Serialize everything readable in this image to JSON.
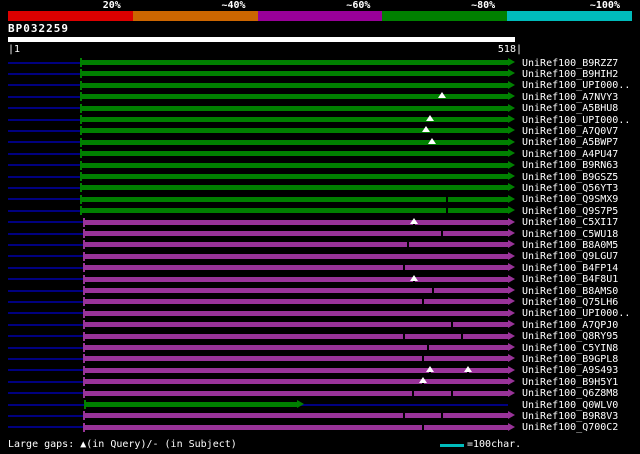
{
  "colors": {
    "background": "#000000",
    "text": "#ffffff",
    "navy_line": "#000080",
    "green_bar": "#008000",
    "purple_bar": "#993399",
    "cyan": "#00bbbb"
  },
  "identity_scale": {
    "labels": [
      "20%",
      "~40%",
      "~60%",
      "~80%",
      "~100%"
    ],
    "colors": [
      "#dd0000",
      "#cc6600",
      "#990099",
      "#008000",
      "#00bbbb"
    ]
  },
  "query": {
    "name": "BP032259",
    "ruler_start": "|1",
    "ruler_end": "518|",
    "length": 518
  },
  "chart_data": {
    "type": "bar",
    "subtype": "sequence-alignment-overview",
    "x_domain": [
      1,
      518
    ],
    "query_name": "BP032259",
    "rows": [
      {
        "label": "UniRef100_B9RZZ7",
        "color": "green",
        "start": 75,
        "end": 518,
        "query_gaps": [],
        "subject_gaps": []
      },
      {
        "label": "UniRef100_B9HIH2",
        "color": "green",
        "start": 75,
        "end": 518,
        "query_gaps": [],
        "subject_gaps": []
      },
      {
        "label": "UniRef100_UPI000..",
        "color": "green",
        "start": 75,
        "end": 518,
        "query_gaps": [],
        "subject_gaps": []
      },
      {
        "label": "UniRef100_A7NVY3",
        "color": "green",
        "start": 75,
        "end": 518,
        "query_gaps": [
          450
        ],
        "subject_gaps": []
      },
      {
        "label": "UniRef100_A5BHU8",
        "color": "green",
        "start": 75,
        "end": 518,
        "query_gaps": [],
        "subject_gaps": []
      },
      {
        "label": "UniRef100_UPI000..",
        "color": "green",
        "start": 75,
        "end": 518,
        "query_gaps": [
          437
        ],
        "subject_gaps": []
      },
      {
        "label": "UniRef100_A7Q0V7",
        "color": "green",
        "start": 75,
        "end": 518,
        "query_gaps": [
          433
        ],
        "subject_gaps": []
      },
      {
        "label": "UniRef100_A5BWP7",
        "color": "green",
        "start": 75,
        "end": 518,
        "query_gaps": [
          439
        ],
        "subject_gaps": []
      },
      {
        "label": "UniRef100_A4PU47",
        "color": "green",
        "start": 75,
        "end": 518,
        "query_gaps": [],
        "subject_gaps": []
      },
      {
        "label": "UniRef100_B9RN63",
        "color": "green",
        "start": 75,
        "end": 518,
        "query_gaps": [],
        "subject_gaps": []
      },
      {
        "label": "UniRef100_B9GSZ5",
        "color": "green",
        "start": 75,
        "end": 518,
        "query_gaps": [],
        "subject_gaps": []
      },
      {
        "label": "UniRef100_Q56YT3",
        "color": "green",
        "start": 75,
        "end": 518,
        "query_gaps": [],
        "subject_gaps": []
      },
      {
        "label": "UniRef100_Q9SMX9",
        "color": "green",
        "start": 75,
        "end": 518,
        "query_gaps": [],
        "subject_gaps": [
          455
        ]
      },
      {
        "label": "UniRef100_Q9S7P5",
        "color": "green",
        "start": 75,
        "end": 518,
        "query_gaps": [],
        "subject_gaps": [
          455
        ]
      },
      {
        "label": "UniRef100_C5XI17",
        "color": "purple",
        "start": 79,
        "end": 518,
        "query_gaps": [
          421
        ],
        "subject_gaps": [
          421
        ]
      },
      {
        "label": "UniRef100_C5WU18",
        "color": "purple",
        "start": 79,
        "end": 518,
        "query_gaps": [],
        "subject_gaps": [
          450
        ]
      },
      {
        "label": "UniRef100_B8A0M5",
        "color": "purple",
        "start": 79,
        "end": 518,
        "query_gaps": [],
        "subject_gaps": [
          415
        ]
      },
      {
        "label": "UniRef100_Q9LGU7",
        "color": "purple",
        "start": 79,
        "end": 518,
        "query_gaps": [],
        "subject_gaps": []
      },
      {
        "label": "UniRef100_B4FP14",
        "color": "purple",
        "start": 79,
        "end": 518,
        "query_gaps": [],
        "subject_gaps": [
          410
        ]
      },
      {
        "label": "UniRef100_B4F8U1",
        "color": "purple",
        "start": 79,
        "end": 518,
        "query_gaps": [
          421
        ],
        "subject_gaps": [
          421
        ]
      },
      {
        "label": "UniRef100_B8AMS0",
        "color": "purple",
        "start": 79,
        "end": 518,
        "query_gaps": [],
        "subject_gaps": [
          440
        ]
      },
      {
        "label": "UniRef100_Q75LH6",
        "color": "purple",
        "start": 79,
        "end": 518,
        "query_gaps": [],
        "subject_gaps": [
          430
        ]
      },
      {
        "label": "UniRef100_UPI000..",
        "color": "purple",
        "start": 79,
        "end": 518,
        "query_gaps": [],
        "subject_gaps": []
      },
      {
        "label": "UniRef100_A7QPJ0",
        "color": "purple",
        "start": 79,
        "end": 518,
        "query_gaps": [],
        "subject_gaps": [
          460
        ]
      },
      {
        "label": "UniRef100_Q8RY95",
        "color": "purple",
        "start": 79,
        "end": 518,
        "query_gaps": [],
        "subject_gaps": [
          410,
          470
        ]
      },
      {
        "label": "UniRef100_C5YIN8",
        "color": "purple",
        "start": 79,
        "end": 518,
        "query_gaps": [],
        "subject_gaps": [
          435
        ]
      },
      {
        "label": "UniRef100_B9GPL8",
        "color": "purple",
        "start": 79,
        "end": 518,
        "query_gaps": [],
        "subject_gaps": [
          430
        ]
      },
      {
        "label": "UniRef100_A9S493",
        "color": "purple",
        "start": 79,
        "end": 518,
        "query_gaps": [
          437,
          477
        ],
        "subject_gaps": [
          437,
          477
        ]
      },
      {
        "label": "UniRef100_B9H5Y1",
        "color": "purple",
        "start": 79,
        "end": 518,
        "query_gaps": [
          430
        ],
        "subject_gaps": [
          430
        ]
      },
      {
        "label": "UniRef100_Q6Z8M8",
        "color": "purple",
        "start": 79,
        "end": 518,
        "query_gaps": [],
        "subject_gaps": [
          420,
          460
        ]
      },
      {
        "label": "UniRef100_Q0WLV0",
        "color": "green",
        "start": 80,
        "end": 300,
        "query_gaps": [],
        "subject_gaps": []
      },
      {
        "label": "UniRef100_B9R8V3",
        "color": "purple",
        "start": 79,
        "end": 518,
        "query_gaps": [],
        "subject_gaps": [
          410,
          450
        ]
      },
      {
        "label": "UniRef100_Q700C2",
        "color": "purple",
        "start": 79,
        "end": 518,
        "query_gaps": [],
        "subject_gaps": [
          430
        ]
      }
    ]
  },
  "footer": {
    "large_gaps_label": "Large gaps: ▲(in Query)/- (in Subject)",
    "scale_label": "=100char."
  }
}
